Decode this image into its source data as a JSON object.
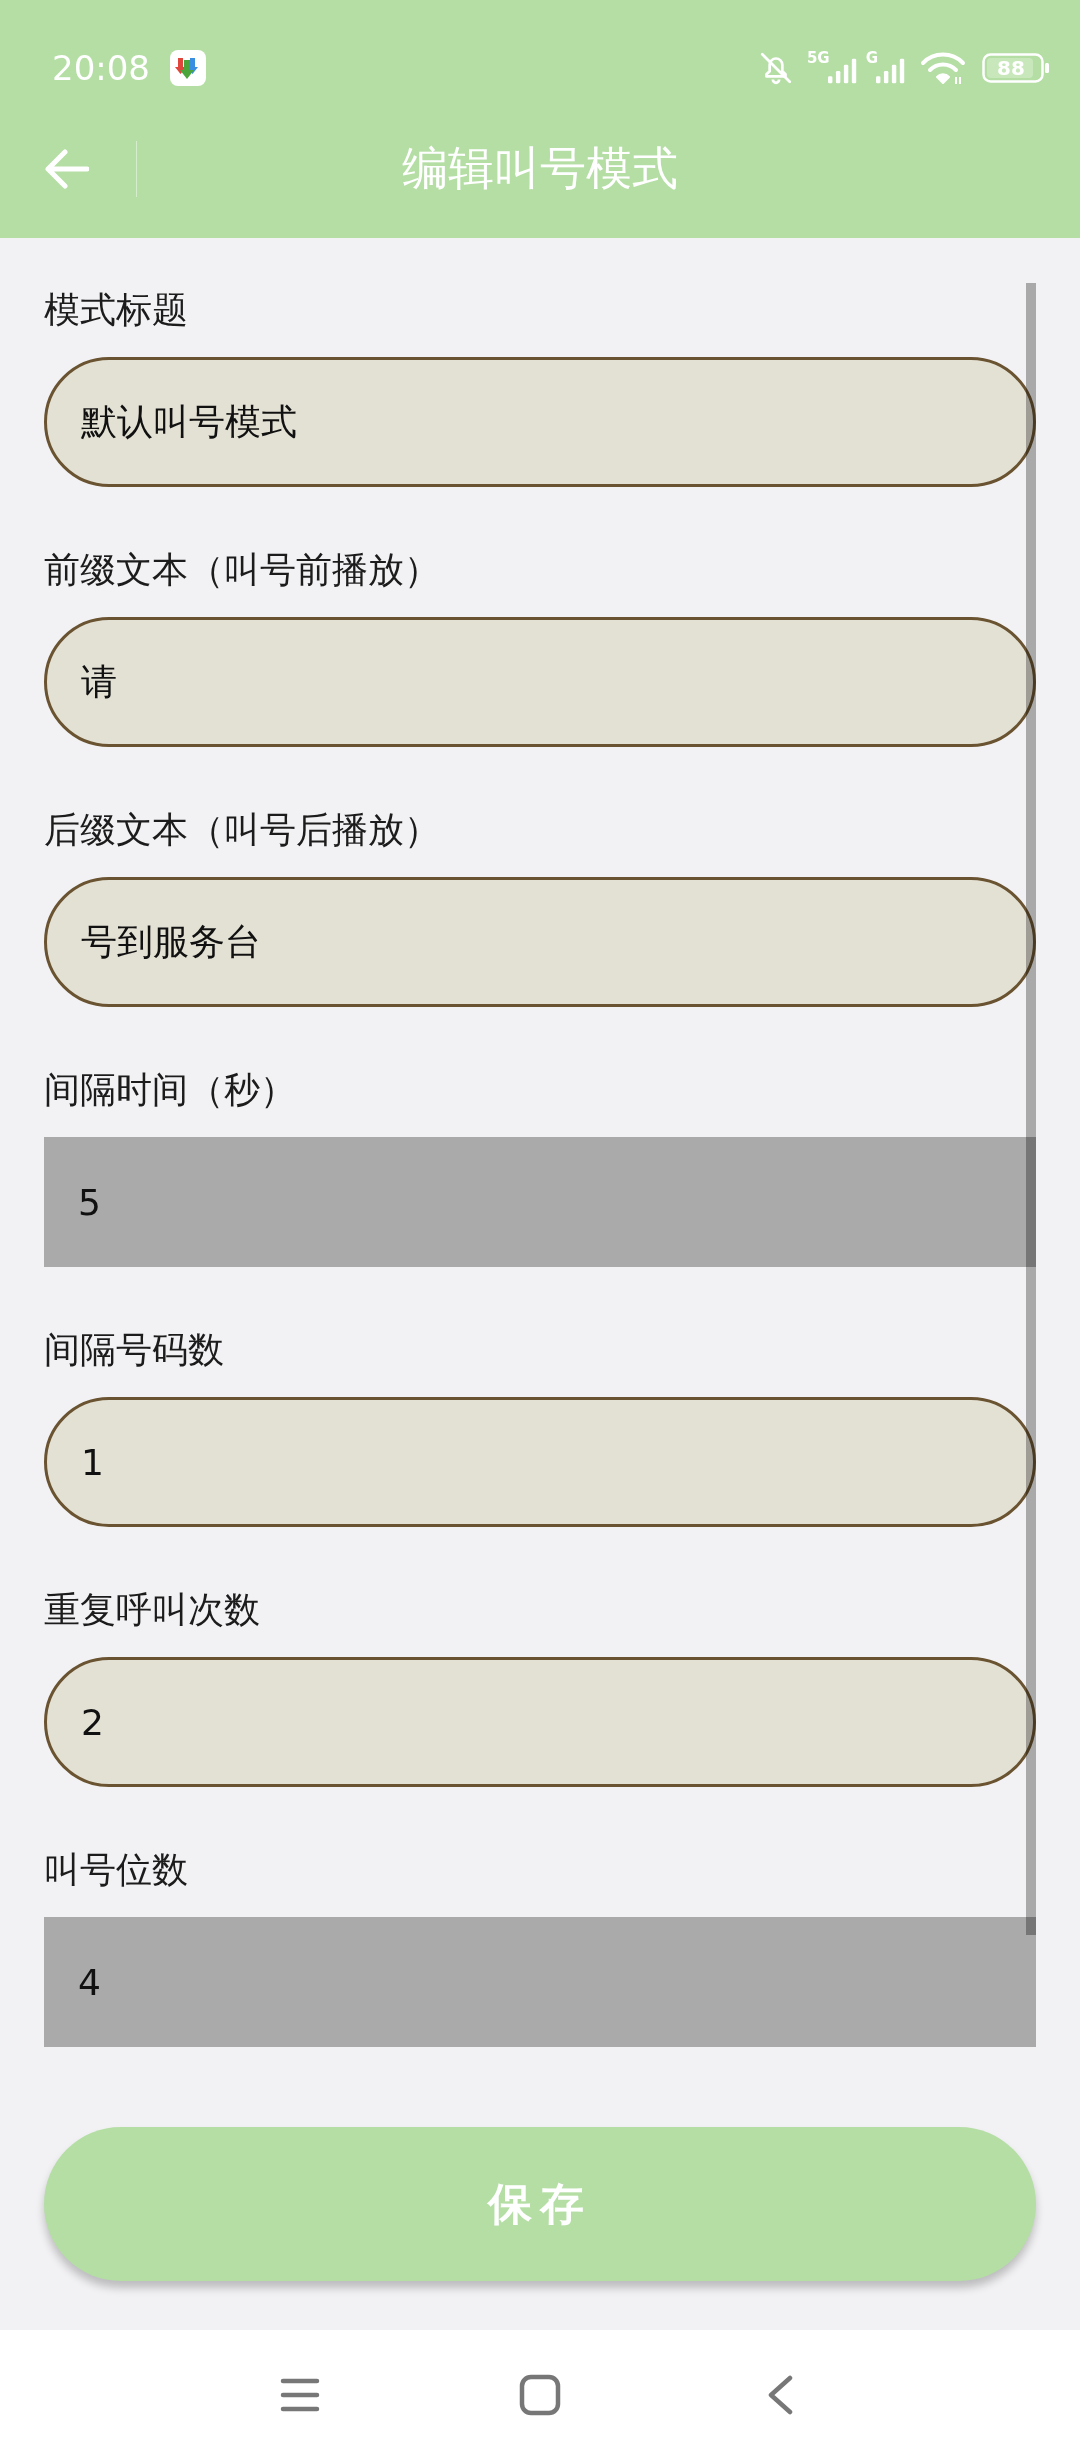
{
  "status_bar": {
    "time": "20:08",
    "signals": [
      "5G",
      "G"
    ],
    "battery": "88"
  },
  "toolbar": {
    "title": "编辑叫号模式"
  },
  "fields": [
    {
      "label": "模式标题",
      "value": "默认叫号模式",
      "disabled": false
    },
    {
      "label": "前缀文本（叫号前播放）",
      "value": "请",
      "disabled": false
    },
    {
      "label": "后缀文本（叫号后播放）",
      "value": "号到服务台",
      "disabled": false
    },
    {
      "label": "间隔时间（秒）",
      "value": "5",
      "disabled": true
    },
    {
      "label": "间隔号码数",
      "value": "1",
      "disabled": false
    },
    {
      "label": "重复呼叫次数",
      "value": "2",
      "disabled": false
    },
    {
      "label": "叫号位数",
      "value": "4",
      "disabled": true
    }
  ],
  "save_button": {
    "label": "保存"
  }
}
